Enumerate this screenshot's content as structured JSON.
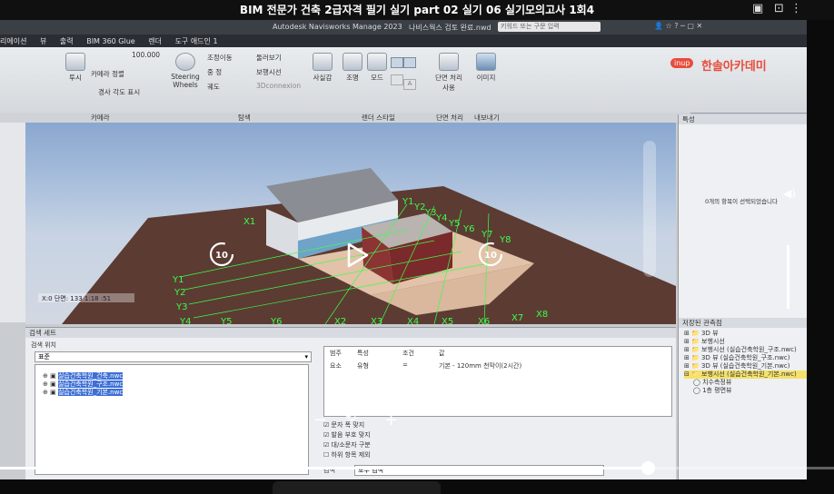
{
  "video": {
    "title": "BIM 전문가 건축 2급자격 필기 실기 part 02 실기 06 실기모의고사 1회4",
    "rewind_label": "10",
    "forward_label": "10",
    "progress_fraction": 0.777
  },
  "app": {
    "window_title": "Autodesk Navisworks Manage 2023",
    "file_title": "나비스웍스 검토 완료.nwd",
    "search_placeholder": "키워드 또는 구문 입력",
    "menu": [
      "리에이션",
      "뷰",
      "출력",
      "BIM 360 Glue",
      "렌더",
      "도구 애드인 1"
    ],
    "logo_text": "한솔아카데미",
    "logo_badge": "inup"
  },
  "ribbon": {
    "left_groups": [
      {
        "label": "투시",
        "small": "100.000"
      },
      {
        "label": "카메라 정렬"
      },
      {
        "label": "경사 각도 표시"
      }
    ],
    "nav_items": [
      "Steering Wheels",
      "조정이동",
      "중 정",
      "궤도",
      "둘러보기",
      "보행시선",
      "3Dconnexion"
    ],
    "big_buttons": [
      {
        "label": "사실감"
      },
      {
        "label": "조명"
      },
      {
        "label": "모드"
      },
      {
        "label": "단면 처리 사용"
      },
      {
        "label": "이미지"
      }
    ],
    "footer": [
      "카메라",
      "탐색",
      "렌더 스타일",
      "단면 처리",
      "내보내기"
    ]
  },
  "viewport": {
    "scale_label": "X:0 단면: 133 1:18 :51",
    "grid_labels_left": [
      "Y1",
      "Y2",
      "Y3",
      "Y4",
      "Y5",
      "Y6"
    ],
    "grid_labels_bottom": [
      "X2",
      "X3",
      "X4",
      "X5",
      "X6",
      "X7",
      "X8"
    ],
    "grid_labels_top": [
      "Y1",
      "Y2",
      "Y3",
      "Y4",
      "Y5",
      "Y6",
      "Y7",
      "Y8"
    ],
    "grid_label_x1": "X1"
  },
  "right_panel": {
    "title": "특성",
    "empty_message": "0개의 항목이 선택되었습니다",
    "saved_views_title": "저장된 관측점",
    "saved_views": [
      "3D 뷰",
      "보행시선",
      "보행시선 (실습건축학원_구조.nwc)",
      "3D 뷰 (실습건축학원_구조.nwc)",
      "3D 뷰 (실습건축학원_기본.nwc)",
      "보행시선 (실습건축학원_기본.nwc)",
      "치수측정뷰",
      "1층 평면뷰"
    ]
  },
  "bottom_panel": {
    "header": "검색 세트",
    "left_title": "검색 위치",
    "dropdown_value": "표준",
    "items": [
      "실습건축학원_건축.nwc",
      "실습건축학원_구조.nwc",
      "실습건축학원_기본.nwc"
    ],
    "table_headers": [
      "범주",
      "특성",
      "조건",
      "값"
    ],
    "table_row": [
      "요소",
      "유형",
      "=",
      "기본 - 120mm 천막이(2시간)"
    ],
    "checkboxes": [
      "문자 폭 맞지",
      "발음 부호 맞지",
      "대/소문자 구분",
      "하위 항목 제외"
    ],
    "search_label": "검색",
    "search_value": "모두 검색"
  }
}
